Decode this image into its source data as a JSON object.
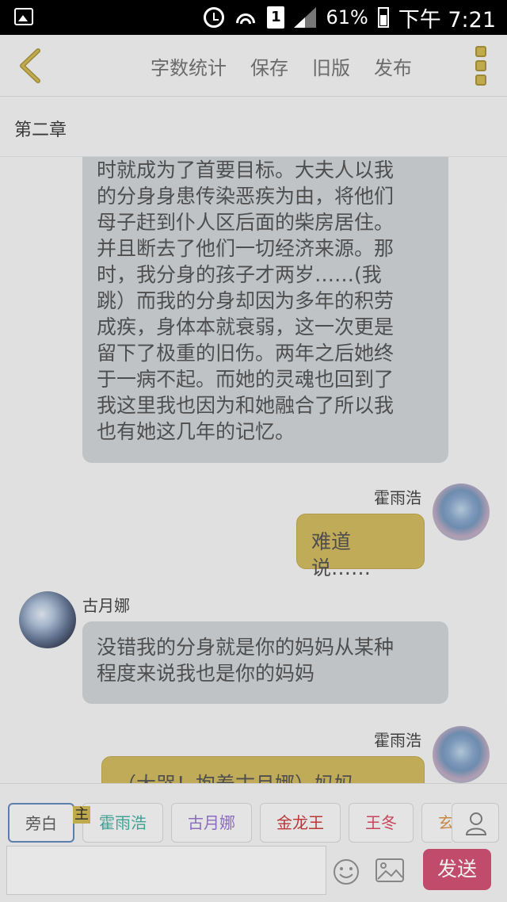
{
  "status_bar": {
    "sim_label": "1",
    "battery": "61%",
    "time": "下午 7:21",
    "icons": [
      "gallery-icon",
      "alarm-icon",
      "wifi-icon",
      "sim-icon",
      "signal-icon",
      "battery-icon"
    ]
  },
  "nav": {
    "actions": [
      "字数统计",
      "保存",
      "旧版",
      "发布"
    ],
    "icons": [
      "back-arrow-icon",
      "more-icon"
    ]
  },
  "chapter": {
    "title": "第二章"
  },
  "messages": [
    {
      "side": "left",
      "text": "时就成为了首要目标。大夫人以我\n的分身身患传染恶疾为由，将他们\n母子赶到仆人区后面的柴房居住。\n并且断去了他们一切经济来源。那\n时，我分身的孩子才两岁……(我\n跳）而我的分身却因为多年的积劳\n成疾，身体本就衰弱，这一次更是\n留下了极重的旧伤。两年之后她终\n于一病不起。而她的灵魂也回到了\n我这里我也因为和她融合了所以我\n也有她这几年的记忆。"
    },
    {
      "side": "right",
      "name": "霍雨浩",
      "text": "难道说……"
    },
    {
      "side": "left",
      "name": "古月娜",
      "text": "没错我的分身就是你的妈妈从某种\n程度来说我也是你的妈妈"
    },
    {
      "side": "right",
      "name": "霍雨浩",
      "text": "（大哭！抱着古月娜）妈妈……呜"
    }
  ],
  "bottom": {
    "roles": [
      "旁白",
      "霍雨浩",
      "古月娜",
      "金龙王",
      "王冬",
      "玄老"
    ],
    "main_tag": "主",
    "input_placeholder": "",
    "send_label": "发送",
    "role_colors": [
      "#555555",
      "#3aa79a",
      "#8f6cc6",
      "#c03030",
      "#d04058",
      "#d08a40"
    ]
  },
  "colors": {
    "accent": "#c8b04a",
    "send": "#c9476a",
    "left_bubble": "#c8ccd0",
    "right_bubble": "#c9b155"
  }
}
